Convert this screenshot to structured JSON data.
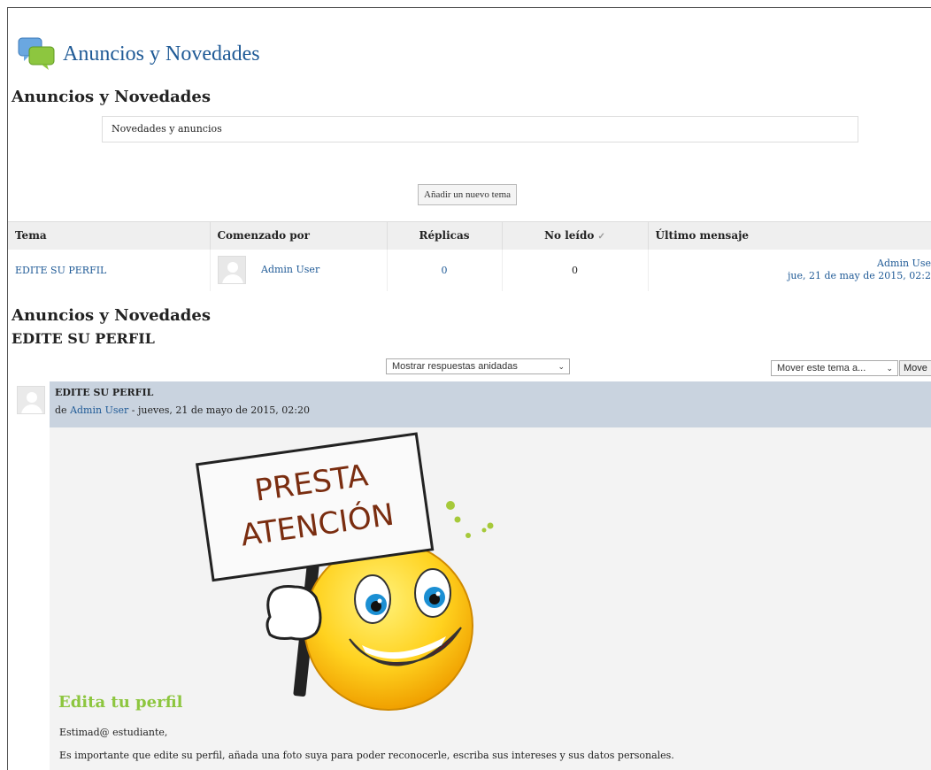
{
  "page": {
    "title": "Anuncios y Novedades"
  },
  "forum": {
    "heading": "Anuncios y Novedades",
    "intro": "Novedades y anuncios",
    "add_topic_button": "Añadir un nuevo tema"
  },
  "table": {
    "headers": {
      "topic": "Tema",
      "started_by": "Comenzado por",
      "replies": "Réplicas",
      "unread": "No leído",
      "last_post": "Último mensaje"
    },
    "rows": [
      {
        "topic": "EDITE SU PERFIL",
        "author": "Admin User",
        "replies": "0",
        "unread": "0",
        "last_post_author": "Admin Use",
        "last_post_date": "jue, 21 de may de 2015, 02:2"
      }
    ]
  },
  "discussion": {
    "forum_heading": "Anuncios y Novedades",
    "topic_heading": "EDITE SU PERFIL",
    "display_mode": "Mostrar respuestas anidadas",
    "move_select": "Mover este tema a...",
    "move_button": "Move"
  },
  "post": {
    "subject": "EDITE SU PERFIL",
    "by_prefix": "de",
    "author": "Admin User",
    "date": "- jueves, 21 de mayo de 2015, 02:20",
    "sign_line1": "PRESTA",
    "sign_line2": "ATENCIÓN",
    "heading": "Edita tu perfil",
    "greeting": "Estimad@ estudiante,",
    "paragraph": "Es importante que edite su perfil, añada una foto suya para poder reconocerle, escriba sus intereses y sus datos personales."
  },
  "colors": {
    "link": "#1f5a96",
    "accent_green": "#8dc63f",
    "post_header": "#c9d3df"
  },
  "icons": [
    "forum-chat-icon",
    "user-avatar-icon",
    "unread-check-icon",
    "chevron-down-icon"
  ]
}
